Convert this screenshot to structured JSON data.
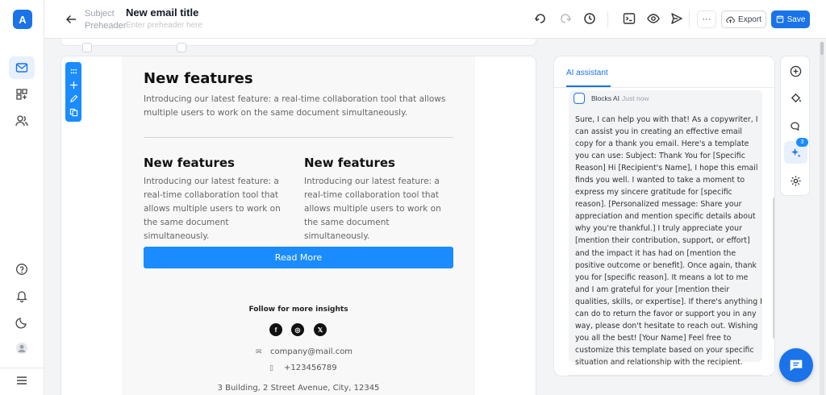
{
  "app": {
    "logo_letter": "A"
  },
  "header": {
    "subject_label": "Subject",
    "subject_value": "New email title",
    "preheader_label": "Preheader",
    "preheader_placeholder": "Enter preheader here",
    "export_label": "Export",
    "save_label": "Save",
    "more_label": "···"
  },
  "email": {
    "hero_title": "New features",
    "hero_text": "Introducing our latest feature: a real-time collaboration tool that allows multiple users to work on the same document simultaneously.",
    "col1_title": "New features",
    "col1_text": "Introducing our latest feature: a real-time collaboration tool that allows multiple users to work on the same document simultaneously.",
    "col2_title": "New features",
    "col2_text": "Introducing our latest feature: a real-time collaboration tool that allows multiple users to work on the same document simultaneously.",
    "button_label": "Read More",
    "follow_text": "Follow for more insights",
    "social": [
      "f",
      "◎",
      "𝕏"
    ],
    "email_contact": "company@mail.com",
    "phone_contact": "+123456789",
    "address": "3 Building, 2 Street Avenue, City, 12345"
  },
  "ai": {
    "tab_label": "AI assistant",
    "sender": "Blocks AI",
    "time": "Just now",
    "message": "Sure, I can help you with that! As a copywriter, I can assist you in creating an effective email copy for a thank you email. Here's a template you can use: Subject: Thank You for [Specific Reason] Hi [Recipient's Name], I hope this email finds you well. I wanted to take a moment to express my sincere gratitude for [specific reason]. [Personalized message: Share your appreciation and mention specific details about why you're thankful.] I truly appreciate your [mention their contribution, support, or effort] and the impact it has had on [mention the positive outcome or benefit]. Once again, thank you for [specific reason]. It means a lot to me and I am grateful for your [mention their qualities, skills, or expertise]. If there's anything I can do to return the favor or support you in any way, please don't hesitate to reach out. Wishing you all the best! [Your Name] Feel free to customize this template based on your specific situation and relationship with the recipient."
  },
  "side_tools": {
    "badge_count": "3"
  },
  "colors": {
    "accent": "#1a73e8",
    "email_button": "#1a8cff"
  }
}
